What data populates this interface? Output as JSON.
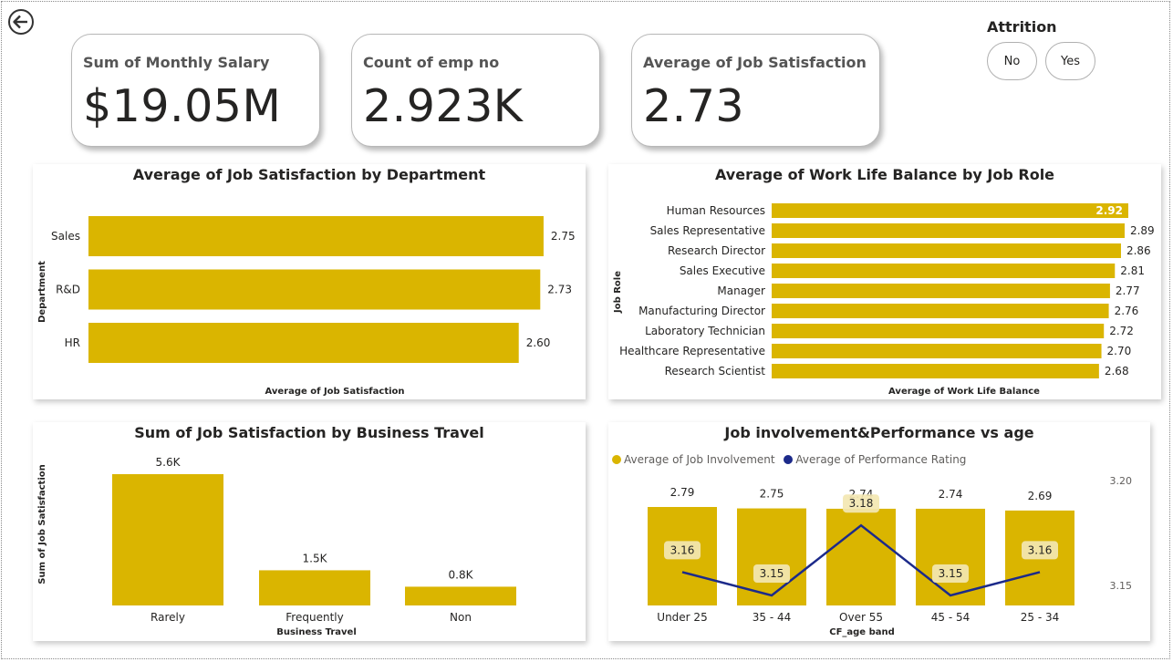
{
  "kpis": [
    {
      "label": "Sum of Monthly Salary",
      "value": "$19.05M"
    },
    {
      "label": "Count of emp no",
      "value": "2.923K"
    },
    {
      "label": "Average of Job Satisfaction",
      "value": "2.73"
    }
  ],
  "slicer": {
    "title": "Attrition",
    "options": [
      "No",
      "Yes"
    ]
  },
  "colors": {
    "bar": "#DAB500",
    "line": "#1C2A8A",
    "label_bg": "#F3E7B2"
  },
  "chart_data": [
    {
      "type": "bar",
      "orientation": "horizontal",
      "title": "Average of Job Satisfaction by Department",
      "xlabel": "Average of Job Satisfaction",
      "ylabel": "Department",
      "categories": [
        "Sales",
        "R&D",
        "HR"
      ],
      "values": [
        2.75,
        2.73,
        2.6
      ],
      "value_labels": [
        "2.75",
        "2.73",
        "2.60"
      ],
      "xlim": [
        0,
        2.8
      ]
    },
    {
      "type": "bar",
      "orientation": "horizontal",
      "title": "Average of Work Life Balance by Job Role",
      "xlabel": "Average of Work Life Balance",
      "ylabel": "Job Role",
      "categories": [
        "Human Resources",
        "Sales Representative",
        "Research Director",
        "Sales Executive",
        "Manager",
        "Manufacturing Director",
        "Laboratory Technician",
        "Healthcare Representative",
        "Research Scientist"
      ],
      "values": [
        2.92,
        2.89,
        2.86,
        2.81,
        2.77,
        2.76,
        2.72,
        2.7,
        2.68
      ],
      "value_labels": [
        "2.92",
        "2.89",
        "2.86",
        "2.81",
        "2.77",
        "2.76",
        "2.72",
        "2.70",
        "2.68"
      ],
      "xlim": [
        0,
        2.92
      ]
    },
    {
      "type": "bar",
      "title": "Sum of Job Satisfaction by Business Travel",
      "xlabel": "Business Travel",
      "ylabel": "Sum of Job Satisfaction",
      "categories": [
        "Rarely",
        "Frequently",
        "Non"
      ],
      "values": [
        5600,
        1500,
        800
      ],
      "value_labels": [
        "5.6K",
        "1.5K",
        "0.8K"
      ],
      "ylim": [
        0,
        5600
      ]
    },
    {
      "type": "bar",
      "title": "Job involvement&Performance vs age",
      "xlabel": "CF_age band",
      "categories": [
        "Under 25",
        "35 - 44",
        "Over 55",
        "45 - 54",
        "25 - 34"
      ],
      "legend": [
        "Average of Job Involvement",
        "Average of Performance Rating"
      ],
      "legend_position": "top-left",
      "series": [
        {
          "name": "Average of Job Involvement",
          "type": "bar",
          "values": [
            2.79,
            2.75,
            2.74,
            2.74,
            2.69
          ],
          "labels": [
            "2.79",
            "2.75",
            "2.74",
            "2.74",
            "2.69"
          ]
        },
        {
          "name": "Average of Performance Rating",
          "type": "line",
          "axis": "secondary",
          "values": [
            3.16,
            3.15,
            3.18,
            3.15,
            3.16
          ],
          "labels": [
            "3.16",
            "3.15",
            "3.18",
            "3.15",
            "3.16"
          ]
        }
      ],
      "ylim": [
        0,
        2.79
      ],
      "y2ticks": [
        "3.20",
        "3.15"
      ],
      "y2lim": [
        3.14,
        3.2
      ]
    }
  ]
}
